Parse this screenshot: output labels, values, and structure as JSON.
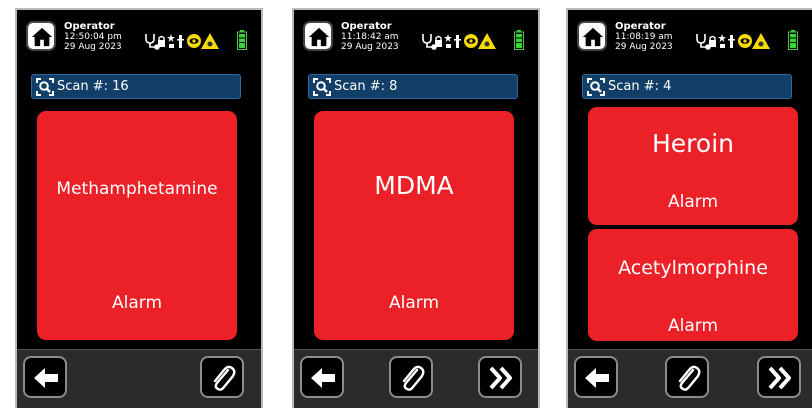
{
  "screens": [
    {
      "operator_label": "Operator",
      "time": "12:50:04 pm",
      "date": "29 Aug 2023",
      "scan_label": "Scan #: 16",
      "results": [
        {
          "drug": "Methamphetamine",
          "status": "Alarm"
        }
      ],
      "toolbar": [
        "back-arrow-icon",
        "paperclip-icon"
      ]
    },
    {
      "operator_label": "Operator",
      "time": "11:18:42 am",
      "date": "29 Aug 2023",
      "scan_label": "Scan #: 8",
      "results": [
        {
          "drug": "MDMA",
          "status": "Alarm"
        }
      ],
      "toolbar": [
        "back-arrow-icon",
        "paperclip-icon",
        "double-chevron-right-icon"
      ]
    },
    {
      "operator_label": "Operator",
      "time": "11:08:19 am",
      "date": "29 Aug 2023",
      "scan_label": "Scan #: 4",
      "results": [
        {
          "drug": "Heroin",
          "status": "Alarm"
        },
        {
          "drug": "Acetylmorphine",
          "status": "Alarm"
        }
      ],
      "toolbar": [
        "back-arrow-icon",
        "paperclip-icon",
        "double-chevron-right-icon"
      ]
    }
  ],
  "colors": {
    "alarm_red": "#ec2027",
    "scan_bar": "#123f68",
    "battery_green": "#3ecf3e",
    "warning_yellow": "#f5d90a",
    "background": "#000000"
  }
}
